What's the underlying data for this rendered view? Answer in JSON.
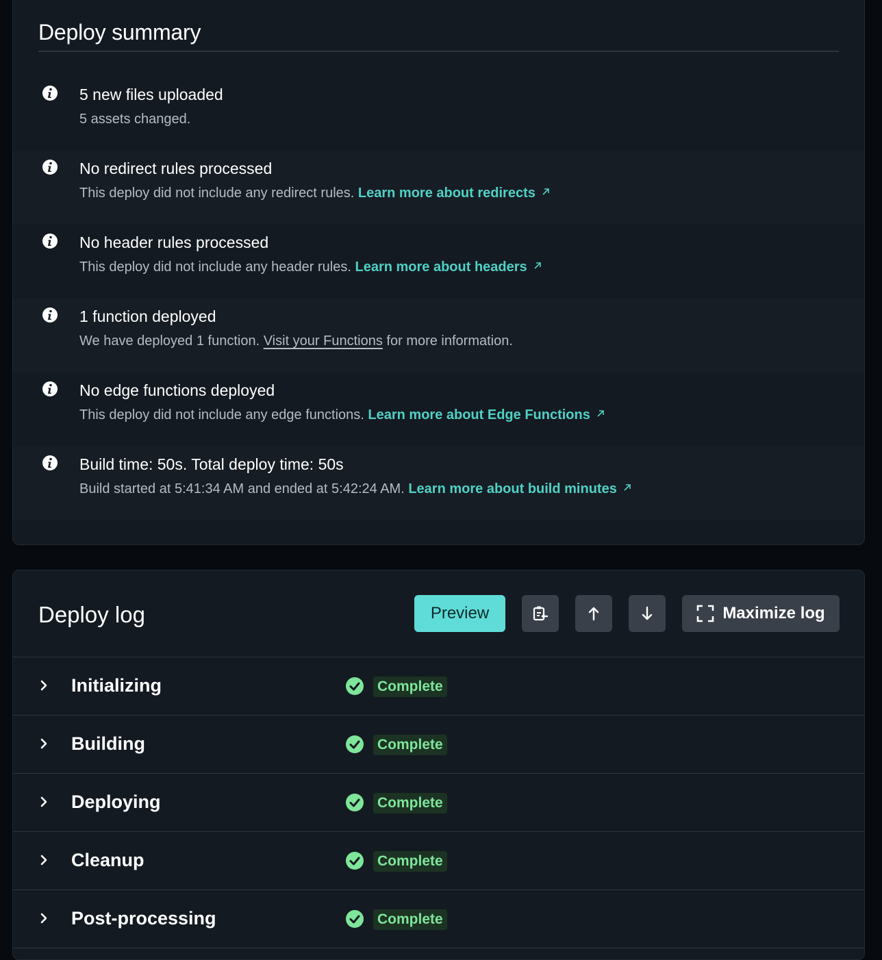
{
  "summary": {
    "title": "Deploy summary",
    "items": [
      {
        "title": "5 new files uploaded",
        "desc": "5 assets changed.",
        "link": ""
      },
      {
        "title": "No redirect rules processed",
        "desc": "This deploy did not include any redirect rules. ",
        "link": "Learn more about redirects"
      },
      {
        "title": "No header rules processed",
        "desc": "This deploy did not include any header rules. ",
        "link": "Learn more about headers"
      },
      {
        "title": "1 function deployed",
        "desc_pre": "We have deployed 1 function. ",
        "desc_link": "Visit your Functions",
        "desc_post": " for more information."
      },
      {
        "title": "No edge functions deployed",
        "desc": "This deploy did not include any edge functions. ",
        "link": "Learn more about Edge Functions"
      },
      {
        "title": "Build time: 50s. Total deploy time: 50s",
        "desc": "Build started at 5:41:34 AM and ended at 5:42:24 AM. ",
        "link": "Learn more about build minutes"
      }
    ]
  },
  "log": {
    "title": "Deploy log",
    "preview_label": "Preview",
    "maximize_label": "Maximize log",
    "steps": [
      {
        "name": "Initializing",
        "status": "Complete"
      },
      {
        "name": "Building",
        "status": "Complete"
      },
      {
        "name": "Deploying",
        "status": "Complete"
      },
      {
        "name": "Cleanup",
        "status": "Complete"
      },
      {
        "name": "Post-processing",
        "status": "Complete"
      }
    ]
  },
  "colors": {
    "accent": "#4fd1c5",
    "preview_bg": "#60dcd8",
    "success": "#7ee59a",
    "card_bg": "#141a21",
    "page_bg": "#070b10"
  },
  "icons": {
    "info": "info-icon",
    "external": "external-link-icon",
    "copy": "copy-to-clipboard-icon",
    "up": "arrow-up-icon",
    "down": "arrow-down-icon",
    "maximize": "maximize-icon",
    "chevron": "chevron-right-icon",
    "check": "check-circle-icon"
  }
}
